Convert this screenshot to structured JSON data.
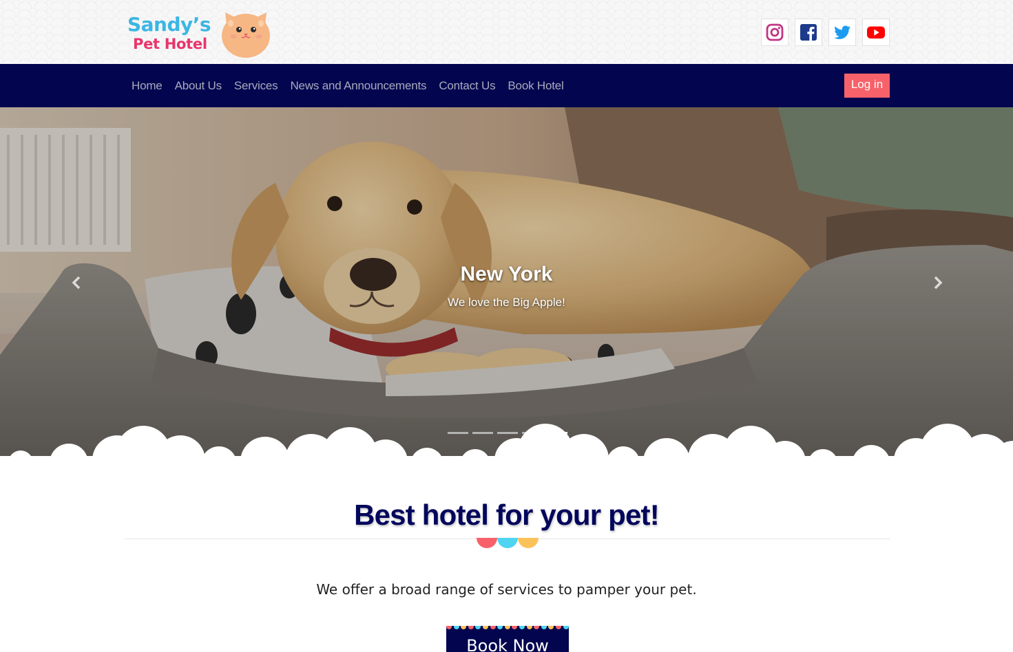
{
  "brand": {
    "name_line1": "Sandy’s",
    "name_line2": "Pet Hotel",
    "mascot": "cat-face-icon",
    "colors": {
      "line1": "#3cb6e3",
      "line2": "#e8356a",
      "mascot": "#f6b784"
    }
  },
  "social": [
    {
      "name": "instagram-icon",
      "color": "#c13584"
    },
    {
      "name": "facebook-icon",
      "color": "#1e3a8a"
    },
    {
      "name": "twitter-icon",
      "color": "#1d9bf0"
    },
    {
      "name": "youtube-icon",
      "color": "#ff0000"
    }
  ],
  "nav": {
    "items": [
      "Home",
      "About Us",
      "Services",
      "News and Announcements",
      "Contact Us",
      "Book Hotel"
    ],
    "login_label": "Log in",
    "background": "#03064f",
    "login_color": "#f7626a"
  },
  "border_colors": [
    "#f7626a",
    "#4fd4f2",
    "#fbc25a"
  ],
  "hero": {
    "caption_title": "New York",
    "caption_sub": "We love the Big Apple!",
    "slide_count": 5,
    "active_slide": 5,
    "prev_icon": "chevron-left-icon",
    "next_icon": "chevron-right-icon"
  },
  "section": {
    "title": "Best hotel for your pet!",
    "intro": "We offer a broad range of services to pamper your pet.",
    "book_label": "Book Now",
    "title_color": "#03065c"
  }
}
